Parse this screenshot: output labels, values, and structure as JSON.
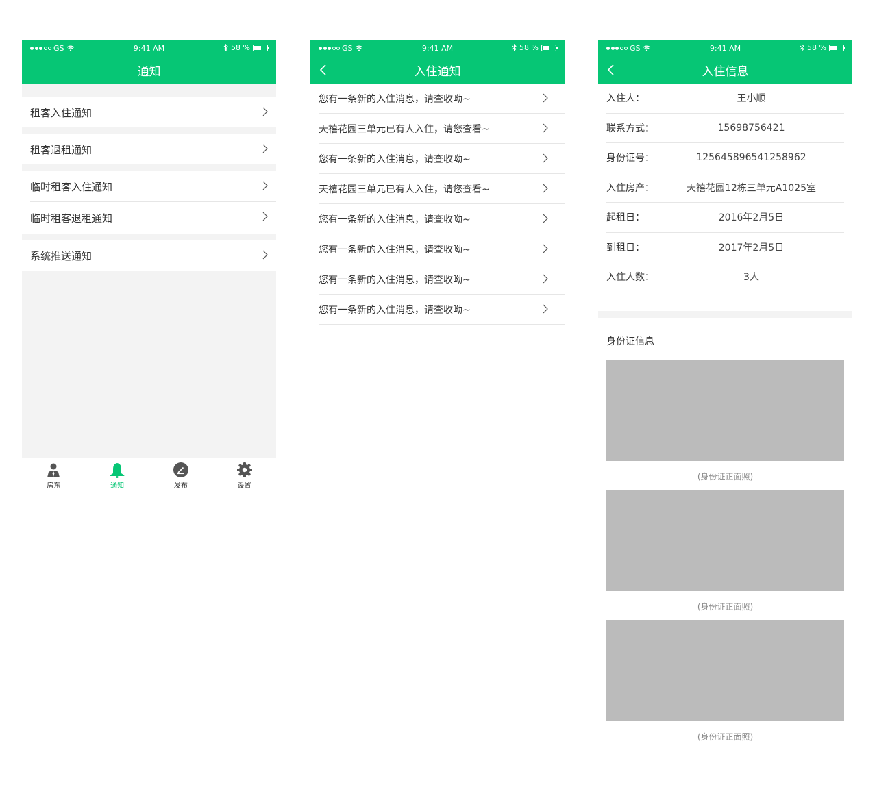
{
  "status_bar": {
    "carrier": "GS",
    "time": "9:41 AM",
    "battery": "58 %",
    "battery_level": 0.58
  },
  "colors": {
    "brand_green": "#06c675",
    "section_gray": "#f3f3f3",
    "placeholder_gray": "#bbbbbb"
  },
  "screen1": {
    "title": "通知",
    "items": [
      {
        "label": "租客入住通知"
      },
      {
        "label": "租客退租通知"
      },
      {
        "label": "临时租客入住通知"
      },
      {
        "label": "临时租客退租通知"
      },
      {
        "label": "系统推送通知"
      }
    ],
    "tabs": [
      {
        "label": "房东",
        "icon": "landlord-icon",
        "active": false
      },
      {
        "label": "通知",
        "icon": "bell-icon",
        "active": true
      },
      {
        "label": "发布",
        "icon": "pen-icon",
        "active": false
      },
      {
        "label": "设置",
        "icon": "gear-icon",
        "active": false
      }
    ]
  },
  "screen2": {
    "title": "入住通知",
    "messages": [
      "您有一条新的入住消息，请查收呦~",
      "天禧花园三单元已有人入住，请您查看~",
      "您有一条新的入住消息，请查收呦~",
      "天禧花园三单元已有人入住，请您查看~",
      "您有一条新的入住消息，请查收呦~",
      "您有一条新的入住消息，请查收呦~",
      "您有一条新的入住消息，请查收呦~",
      "您有一条新的入住消息，请查收呦~"
    ]
  },
  "screen3": {
    "title": "入住信息",
    "fields": [
      {
        "label": "入住人：",
        "value": "王小顺"
      },
      {
        "label": "联系方式：",
        "value": "15698756421"
      },
      {
        "label": "身份证号：",
        "value": "125645896541258962"
      },
      {
        "label": "入住房产：",
        "value": "天禧花园12栋三单元A1025室"
      },
      {
        "label": "起租日：",
        "value": "2016年2月5日"
      },
      {
        "label": "到租日：",
        "value": "2017年2月5日"
      },
      {
        "label": "入住人数：",
        "value": "3人"
      }
    ],
    "id_section_title": "身份证信息",
    "photo_captions": [
      "(身份证正面照)",
      "(身份证正面照)",
      "(身份证正面照)"
    ]
  }
}
